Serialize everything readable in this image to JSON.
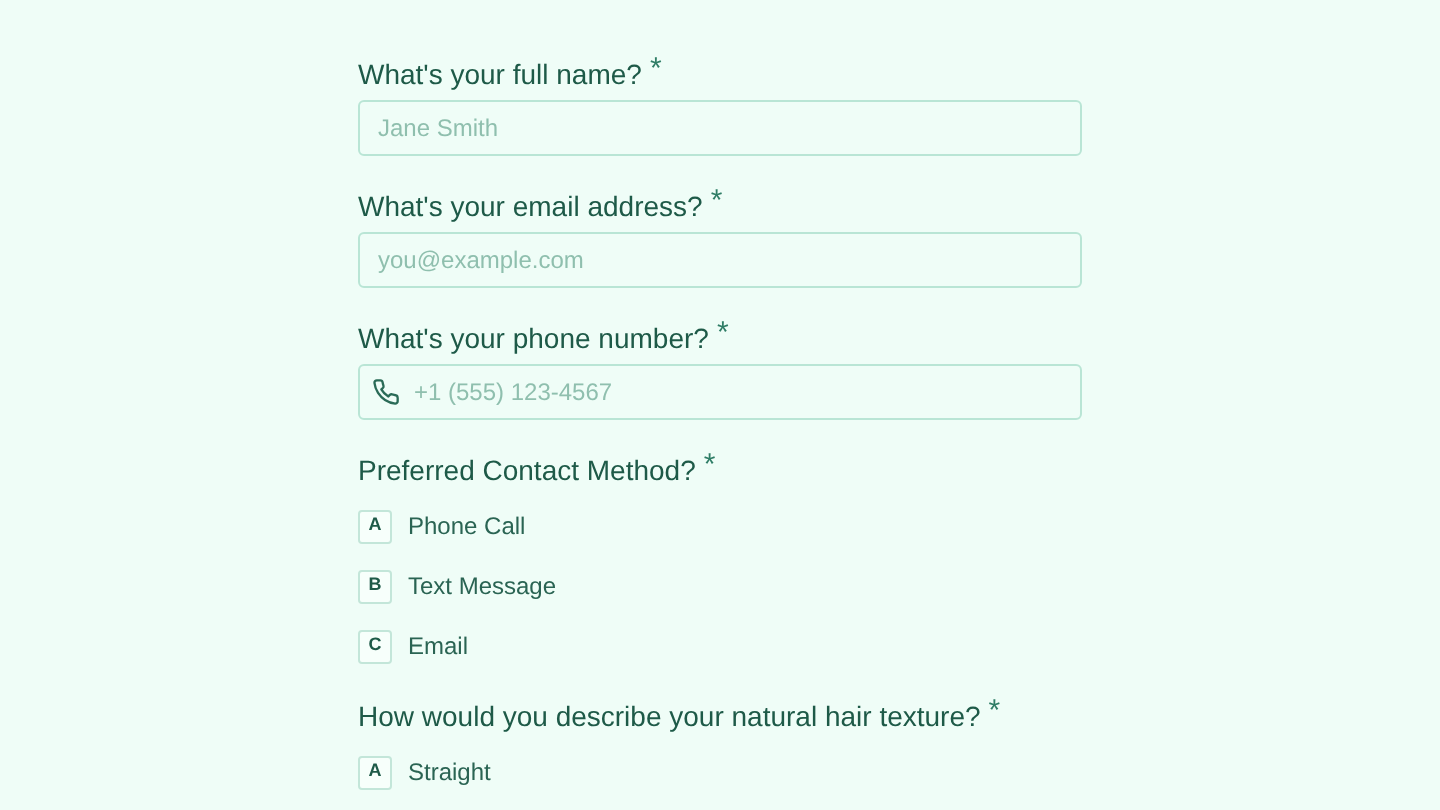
{
  "questions": [
    {
      "kind": "text",
      "label": "What's your full name?",
      "required_mark": "*",
      "placeholder": "Jane Smith"
    },
    {
      "kind": "text",
      "label": "What's your email address?",
      "required_mark": "*",
      "placeholder": "you@example.com"
    },
    {
      "kind": "phone",
      "label": "What's your phone number?",
      "required_mark": "*",
      "placeholder": "+1 (555) 123-4567"
    },
    {
      "kind": "choice",
      "label": "Preferred Contact Method?",
      "required_mark": "*",
      "options": [
        {
          "key": "A",
          "label": "Phone Call",
          "selected": false
        },
        {
          "key": "B",
          "label": "Text Message",
          "selected": false
        },
        {
          "key": "C",
          "label": "Email",
          "selected": false
        }
      ]
    },
    {
      "kind": "choice",
      "label": "How would you describe your natural hair texture?",
      "required_mark": "*",
      "options": [
        {
          "key": "A",
          "label": "Straight",
          "selected": false
        }
      ]
    }
  ]
}
